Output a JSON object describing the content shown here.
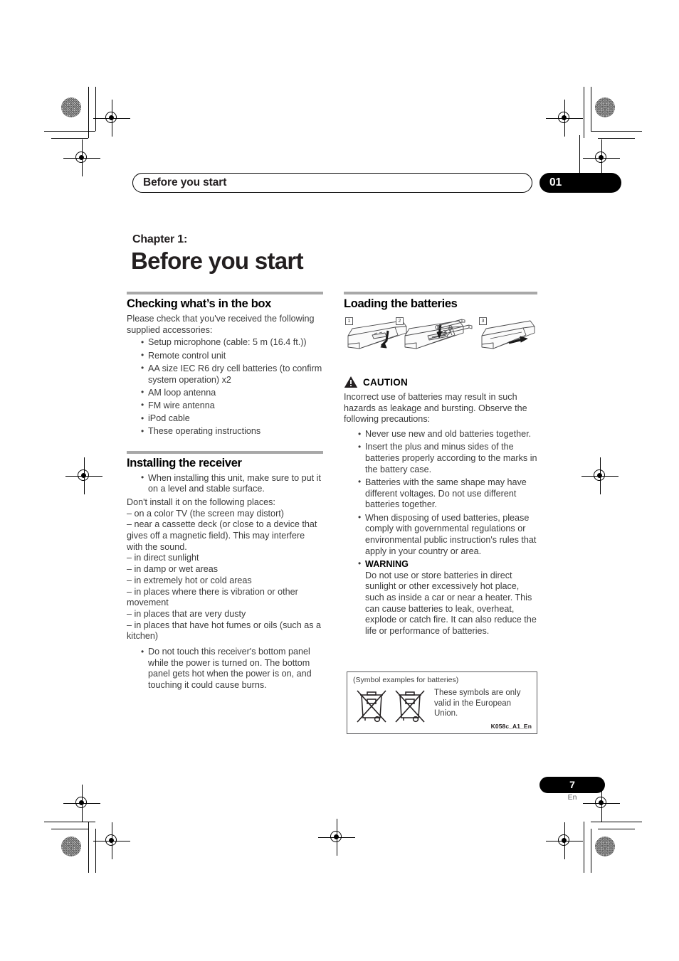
{
  "page": {
    "running_header": "Before you start",
    "chapter_badge": "01",
    "chapter_label": "Chapter 1:",
    "chapter_title": "Before you start",
    "page_number": "7",
    "page_language": "En"
  },
  "left_column": {
    "section1": {
      "heading": "Checking what’s in the box",
      "intro": "Please check that you've received the following supplied accessories:",
      "items": [
        "Setup microphone (cable: 5 m (16.4 ft.))",
        "Remote control unit",
        "AA size IEC R6 dry cell batteries (to confirm system operation) x2",
        "AM loop antenna",
        "FM wire antenna",
        "iPod cable",
        "These operating instructions"
      ]
    },
    "section2": {
      "heading": "Installing the receiver",
      "bullet_top": "When installing this unit, make sure to put it on a level and stable surface.",
      "intro": "Don't install it on the following places:",
      "dash_items": [
        "– on a color TV (the screen may distort)",
        "– near a cassette deck (or close to a device that gives off a magnetic field). This may interfere with the sound.",
        "– in direct sunlight",
        "– in damp or wet areas",
        "– in extremely hot or cold areas",
        "– in places where there is vibration or other movement",
        "– in places that are very dusty",
        "– in places that have hot fumes or oils (such as a kitchen)"
      ],
      "bullet_bottom": "Do not touch this receiver's bottom panel while the power is turned on. The bottom panel gets hot when the power is on, and touching it could cause burns."
    }
  },
  "right_column": {
    "section1": {
      "heading": "Loading the batteries",
      "figure_steps": [
        "1",
        "2",
        "3"
      ],
      "caution_label": "CAUTION",
      "caution_intro": "Incorrect use of batteries may result in such hazards as leakage and bursting. Observe the following precautions:",
      "caution_items": [
        "Never use new and old batteries together.",
        "Insert the plus and minus sides of the batteries properly according to the marks in the battery case.",
        "Batteries with the same shape may have different voltages. Do not use different batteries together.",
        "When disposing of used batteries, please comply with governmental regulations or environmental public instruction's rules that apply in your country or area."
      ],
      "warning_label": "WARNING",
      "warning_text": "Do not use or store batteries in direct sunlight or other excessively hot place, such as inside a car or near a heater. This can cause batteries to leak, overheat, explode or catch fire. It can also reduce the life or performance of batteries."
    },
    "symbol_box": {
      "caption": "(Symbol examples for batteries)",
      "note": "These symbols are only valid in the European Union.",
      "code": "K058c_A1_En"
    }
  },
  "colors": {
    "rule_gray": "#a8a8a8",
    "body_text": "#3b3b3b",
    "heading_text": "#000000",
    "badge_background": "#000000"
  }
}
